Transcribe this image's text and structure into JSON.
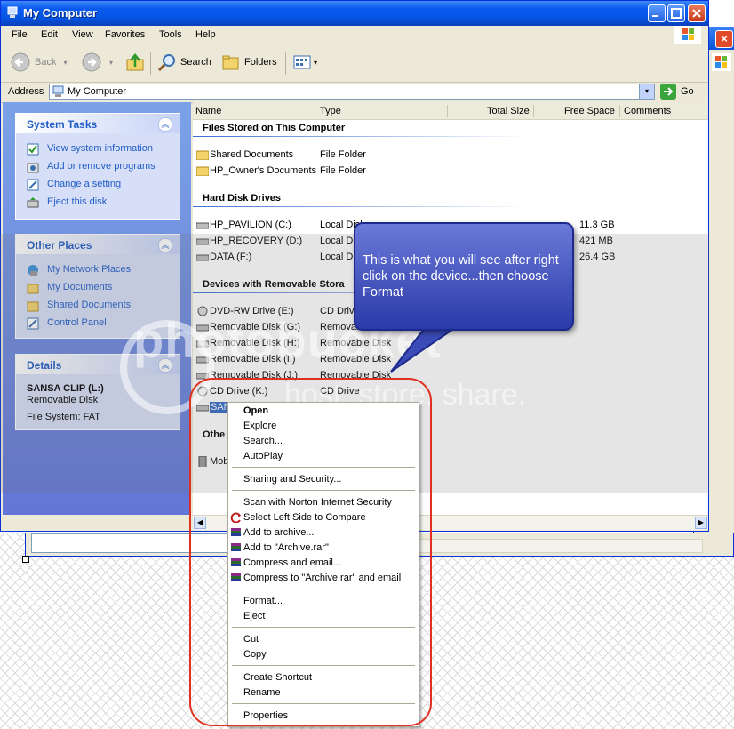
{
  "window": {
    "title": "My Computer"
  },
  "menubar": [
    "File",
    "Edit",
    "View",
    "Favorites",
    "Tools",
    "Help"
  ],
  "toolbar": {
    "back": "Back",
    "search": "Search",
    "folders": "Folders"
  },
  "address": {
    "label": "Address",
    "value": "My Computer",
    "go": "Go"
  },
  "system_tasks": {
    "title": "System Tasks",
    "items": [
      "View system information",
      "Add or remove programs",
      "Change a setting",
      "Eject this disk"
    ]
  },
  "other_places": {
    "title": "Other Places",
    "items": [
      "My Network Places",
      "My Documents",
      "Shared Documents",
      "Control Panel"
    ]
  },
  "details": {
    "title": "Details",
    "name": "SANSA CLIP (L:)",
    "type": "Removable Disk",
    "fs": "File System: FAT"
  },
  "columns": [
    "Name",
    "Type",
    "Total Size",
    "Free Space",
    "Comments"
  ],
  "groups": {
    "files": "Files Stored on This Computer",
    "hdd": "Hard Disk Drives",
    "removable": "Devices with Removable Stora",
    "other": "Othe"
  },
  "files": [
    {
      "name": "Shared Documents",
      "type": "File Folder"
    },
    {
      "name": "HP_Owner's Documents",
      "type": "File Folder"
    }
  ],
  "hdd": [
    {
      "name": "HP_PAVILION (C:)",
      "type": "Local Disk",
      "free": "11.3 GB"
    },
    {
      "name": "HP_RECOVERY (D:)",
      "type": "Local Disk",
      "free": "421 MB"
    },
    {
      "name": "DATA (F:)",
      "type": "Local Disk",
      "free": "26.4 GB"
    }
  ],
  "removable": [
    {
      "name": "DVD-RW Drive (E:)",
      "type": "CD Drive"
    },
    {
      "name": "Removable Disk (G:)",
      "type": "Removable"
    },
    {
      "name": "Removable Disk (H:)",
      "type": "Removable Disk"
    },
    {
      "name": "Removable Disk (I:)",
      "type": "Removable Disk"
    },
    {
      "name": "Removable Disk (J:)",
      "type": "Removable Disk"
    },
    {
      "name": "CD Drive (K:)",
      "type": "CD Drive"
    },
    {
      "name": "SAN",
      "type": ""
    }
  ],
  "other_item": "Mob",
  "callout": "This is what you will see after right click on the device...then choose Format",
  "watermark": {
    "main": "photobucket",
    "sub": "host. store. share."
  },
  "context_menu": {
    "open": "Open",
    "explore": "Explore",
    "search": "Search...",
    "autoplay": "AutoPlay",
    "sharing": "Sharing and Security...",
    "norton": "Scan with Norton Internet Security",
    "compare": "Select Left Side to Compare",
    "archive": "Add to archive...",
    "archive_rar": "Add to \"Archive.rar\"",
    "compress_email": "Compress and email...",
    "compress_rar_email": "Compress to \"Archive.rar\" and email",
    "format": "Format...",
    "eject": "Eject",
    "cut": "Cut",
    "copy": "Copy",
    "shortcut": "Create Shortcut",
    "rename": "Rename",
    "properties": "Properties"
  },
  "colors": {
    "title_blue": "#0a5bf0",
    "task_blue": "#215dc6",
    "callout": "#3b4bb8",
    "red_circle": "#e03020",
    "selection": "#316ac5"
  }
}
